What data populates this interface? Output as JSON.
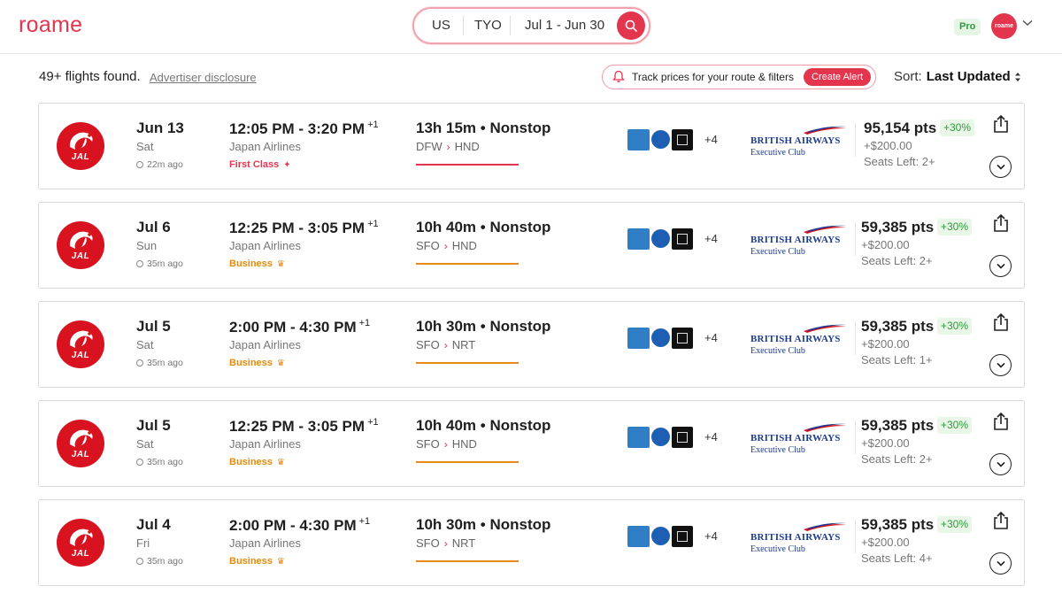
{
  "header": {
    "logo": "roame",
    "search": {
      "origin": "US",
      "destination": "TYO",
      "dates": "Jul 1 - Jun 30"
    },
    "pro_badge": "Pro",
    "avatar_text": "roame"
  },
  "subheader": {
    "results_count": "49+ flights found.",
    "advertiser_disclosure": "Advertiser disclosure",
    "track_text": "Track prices for your route & filters",
    "create_alert": "Create Alert",
    "sort_label": "Sort:",
    "sort_value": "Last Updated"
  },
  "colors": {
    "brand": "#e3354d",
    "business": "#e38b12",
    "first": "#e3354d",
    "green": "#2f9a3a"
  },
  "flights": [
    {
      "date": "Jun 13",
      "dow": "Sat",
      "ago": "22m ago",
      "times": "12:05 PM - 3:20 PM",
      "plus_days": "+1",
      "airline": "Japan Airlines",
      "cabin": "First Class",
      "cabin_type": "first",
      "duration": "13h 15m • Nonstop",
      "from": "DFW",
      "to": "HND",
      "more_programs": "+4",
      "program_name": "BRITISH AIRWAYS",
      "program_sub": "Executive Club",
      "points": "95,154 pts",
      "pct": "+30%",
      "cash": "+$200.00",
      "seats": "Seats Left: 2+"
    },
    {
      "date": "Jul 6",
      "dow": "Sun",
      "ago": "35m ago",
      "times": "12:25 PM - 3:05 PM",
      "plus_days": "+1",
      "airline": "Japan Airlines",
      "cabin": "Business",
      "cabin_type": "biz",
      "duration": "10h 40m • Nonstop",
      "from": "SFO",
      "to": "HND",
      "more_programs": "+4",
      "program_name": "BRITISH AIRWAYS",
      "program_sub": "Executive Club",
      "points": "59,385 pts",
      "pct": "+30%",
      "cash": "+$200.00",
      "seats": "Seats Left: 2+"
    },
    {
      "date": "Jul 5",
      "dow": "Sat",
      "ago": "35m ago",
      "times": "2:00 PM - 4:30 PM",
      "plus_days": "+1",
      "airline": "Japan Airlines",
      "cabin": "Business",
      "cabin_type": "biz",
      "duration": "10h 30m • Nonstop",
      "from": "SFO",
      "to": "NRT",
      "more_programs": "+4",
      "program_name": "BRITISH AIRWAYS",
      "program_sub": "Executive Club",
      "points": "59,385 pts",
      "pct": "+30%",
      "cash": "+$200.00",
      "seats": "Seats Left: 1+"
    },
    {
      "date": "Jul 5",
      "dow": "Sat",
      "ago": "35m ago",
      "times": "12:25 PM - 3:05 PM",
      "plus_days": "+1",
      "airline": "Japan Airlines",
      "cabin": "Business",
      "cabin_type": "biz",
      "duration": "10h 40m • Nonstop",
      "from": "SFO",
      "to": "HND",
      "more_programs": "+4",
      "program_name": "BRITISH AIRWAYS",
      "program_sub": "Executive Club",
      "points": "59,385 pts",
      "pct": "+30%",
      "cash": "+$200.00",
      "seats": "Seats Left: 2+"
    },
    {
      "date": "Jul 4",
      "dow": "Fri",
      "ago": "35m ago",
      "times": "2:00 PM - 4:30 PM",
      "plus_days": "+1",
      "airline": "Japan Airlines",
      "cabin": "Business",
      "cabin_type": "biz",
      "duration": "10h 30m • Nonstop",
      "from": "SFO",
      "to": "NRT",
      "more_programs": "+4",
      "program_name": "BRITISH AIRWAYS",
      "program_sub": "Executive Club",
      "points": "59,385 pts",
      "pct": "+30%",
      "cash": "+$200.00",
      "seats": "Seats Left: 4+"
    }
  ],
  "jal_logo_text": "JAL"
}
